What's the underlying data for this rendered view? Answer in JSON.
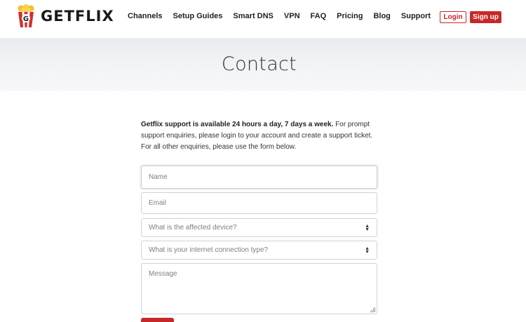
{
  "brand": {
    "name": "GETFLIX",
    "accent": "#c62828"
  },
  "nav": {
    "items": [
      "Channels",
      "Setup Guides",
      "Smart DNS",
      "VPN",
      "FAQ",
      "Pricing",
      "Blog",
      "Support"
    ],
    "login_label": "Login",
    "signup_label": "Sign up"
  },
  "hero": {
    "title": "Contact"
  },
  "intro": {
    "bold": "Getflix support is available 24 hours a day, 7 days a week.",
    "rest": " For prompt support enquiries, please login to your account and create a support ticket. For all other enquiries, please use the form below."
  },
  "form": {
    "name_placeholder": "Name",
    "email_placeholder": "Email",
    "device_placeholder": "What is the affected device?",
    "connection_placeholder": "What is your internet connection type?",
    "message_placeholder": "Message"
  },
  "icons": {
    "logo": "popcorn-icon",
    "select": "sort-arrows-icon",
    "resize": "resize-handle-icon"
  }
}
